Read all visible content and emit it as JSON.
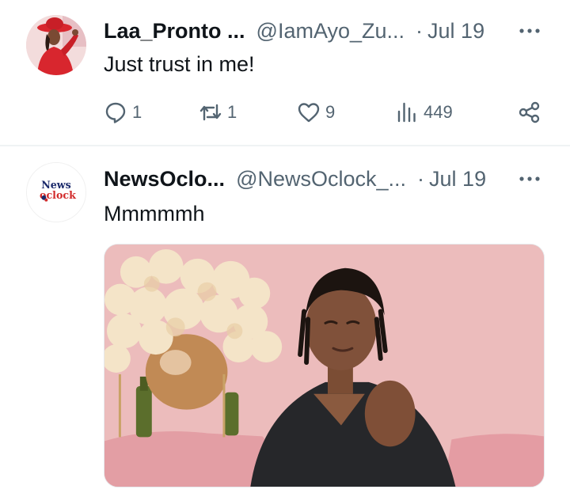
{
  "tweets": [
    {
      "author_name": "Laa_Pronto ...",
      "handle": "@IamAyo_Zu...",
      "separator": "·",
      "date": "Jul 19",
      "text": "Just trust in me!",
      "replies": "1",
      "retweets": "1",
      "likes": "9",
      "views": "449",
      "avatar": "woman-in-red-hat-photo"
    },
    {
      "author_name": "NewsOclo...",
      "handle": "@NewsOclock_...",
      "separator": "·",
      "date": "Jul 19",
      "text": "Mmmmmh",
      "avatar_logo_top": "News",
      "avatar_logo_bottom": "oclock",
      "media": "man-with-locs-beside-flower-vase-on-pink-background-photo"
    }
  ],
  "icons": {
    "more": "more-horizontal-icon",
    "reply": "reply-bubble-icon",
    "retweet": "retweet-arrows-icon",
    "like": "heart-icon",
    "views": "bar-chart-icon",
    "share": "share-nodes-icon"
  },
  "colors": {
    "text_primary": "#0f1419",
    "text_secondary": "#536471",
    "divider": "#eff3f4",
    "logo_blue": "#1b2a6b",
    "logo_red": "#d22b2b"
  }
}
